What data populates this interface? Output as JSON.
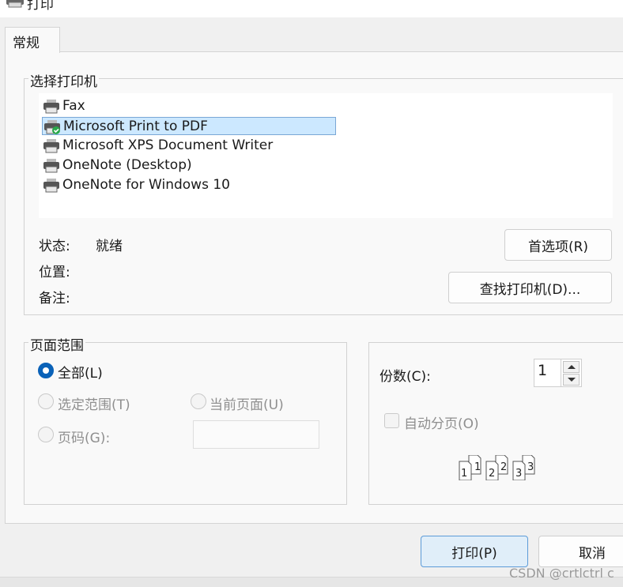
{
  "window": {
    "title": "打印",
    "icon": "printer-icon"
  },
  "tabs": [
    {
      "label": "常规",
      "active": true
    }
  ],
  "printer_group": {
    "title": "选择打印机",
    "printers": [
      {
        "name": "Fax",
        "icon": "printer-icon",
        "selected": false
      },
      {
        "name": "Microsoft Print to PDF",
        "icon": "printer-default-check-icon",
        "selected": true
      },
      {
        "name": "Microsoft XPS Document Writer",
        "icon": "printer-icon",
        "selected": false
      },
      {
        "name": "OneNote (Desktop)",
        "icon": "printer-icon",
        "selected": false
      },
      {
        "name": "OneNote for Windows 10",
        "icon": "printer-icon",
        "selected": false
      }
    ],
    "status_label": "状态:",
    "status_value": "就绪",
    "location_label": "位置:",
    "comment_label": "备注:",
    "preferences_button": "首选项(R)",
    "find_printer_button": "查找打印机(D)..."
  },
  "page_range": {
    "title": "页面范围",
    "all": {
      "label": "全部(L)",
      "checked": true
    },
    "selection": {
      "label": "选定范围(T)",
      "enabled": false
    },
    "current_page": {
      "label": "当前页面(U)",
      "enabled": false
    },
    "pages": {
      "label": "页码(G):",
      "enabled": false,
      "value": ""
    }
  },
  "copies": {
    "label": "份数(C):",
    "value": "1",
    "collate": {
      "label": "自动分页(O)",
      "checked": false,
      "enabled": false
    },
    "collate_icon": "collate-pages-icon",
    "collate_numbers": [
      "1",
      "1",
      "2",
      "2",
      "3",
      "3"
    ]
  },
  "footer": {
    "print_button": "打印(P)",
    "cancel_button": "取消"
  },
  "watermark": "CSDN @crtlctrl c",
  "colors": {
    "selection": "#cce8ff",
    "accent": "#0a62b8",
    "disabled_text": "#8f8f8f"
  }
}
